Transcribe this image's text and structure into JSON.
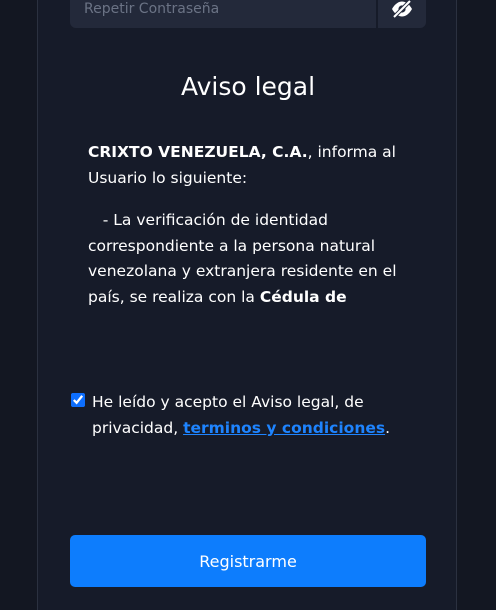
{
  "form": {
    "repeat_password_placeholder": "Repetir Contraseña",
    "toggle_icon": "eye-slash-icon",
    "submit_label": "Registrarme"
  },
  "legal": {
    "title": "Aviso legal",
    "company": "CRIXTO VENEZUELA, C.A.",
    "intro_rest": ", informa al Usuario lo siguiente:",
    "item_text": "   - La verificación de identidad correspondiente a la persona natural venezolana y extranjera residente en el país, se realiza con la ",
    "item_bold": "Cédula de"
  },
  "consent": {
    "checked": true,
    "text": "He leído y acepto el Aviso legal, de privacidad, ",
    "link": "terminos y condiciones",
    "suffix": "."
  },
  "colors": {
    "background": "#131722",
    "accent": "#0d7dfd",
    "link": "#1e84ff"
  }
}
